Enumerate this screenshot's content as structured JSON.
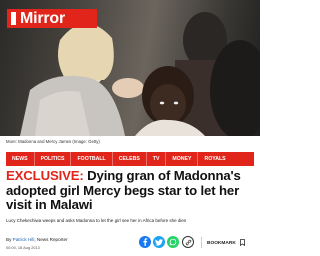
{
  "brand": {
    "name": "Mirror",
    "color": "#e1251b"
  },
  "photo": {
    "caption": "More: Madonna and Mercy James (Image: Getty)"
  },
  "nav": {
    "items": [
      "NEWS",
      "POLITICS",
      "FOOTBALL",
      "CELEBS",
      "TV",
      "MONEY",
      "ROYALS"
    ]
  },
  "article": {
    "label": "EXCLUSIVE:",
    "headline": "Dying gran of Madonna's adopted girl Mercy begs star to let her visit in Malawi",
    "standfirst": "Lucy Chekechiwa weeps and asks Madonna to let the girl see her in Africa before she dies",
    "byline_prefix": "By",
    "author": "Patrick Hill",
    "author_role": ", News Reporter",
    "date": "00:00, 18 Aug 2013"
  },
  "share": {
    "icons": [
      "facebook-icon",
      "twitter-icon",
      "whatsapp-icon",
      "link-icon"
    ],
    "colors": {
      "facebook": "#1877f2",
      "twitter": "#1da1f2",
      "whatsapp": "#25d366",
      "link": "#333333"
    }
  },
  "bookmark": {
    "label": "BOOKMARK"
  }
}
